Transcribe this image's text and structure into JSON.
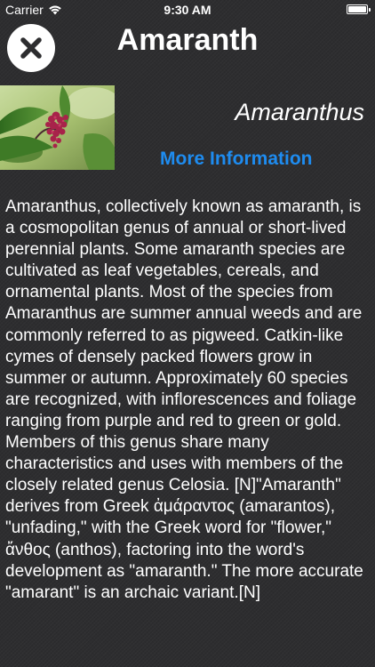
{
  "status_bar": {
    "carrier": "Carrier",
    "time": "9:30 AM",
    "battery_level": 1.0
  },
  "header": {
    "title": "Amaranth",
    "close_icon": "close-x-icon"
  },
  "plant": {
    "photo_icon": "amaranth-flower-photo",
    "scientific_name": "Amaranthus",
    "more_info_label": "More Information",
    "description": "Amaranthus, collectively known as amaranth, is a cosmopolitan genus of annual or short-lived perennial plants. Some amaranth species are cultivated as leaf vegetables, cereals, and ornamental plants. Most of the species from Amaranthus are summer annual weeds and are commonly referred to as pigweed. Catkin-like cymes of densely packed flowers grow in summer or autumn. Approximately 60 species are recognized, with inflorescences and foliage ranging from purple and red to green or gold. Members of this genus share many characteristics and uses with members of the closely related genus Celosia. [N]\"Amaranth\" derives from Greek ἀμάραντος (amarantos), \"unfading,\" with the Greek word for \"flower,\" ἄνθος (anthos), factoring into the word's development as \"amaranth.\" The more accurate \"amarant\" is an archaic variant.[N]"
  },
  "colors": {
    "background": "#2d2d2f",
    "link": "#1e8cf0",
    "text": "#ffffff"
  }
}
